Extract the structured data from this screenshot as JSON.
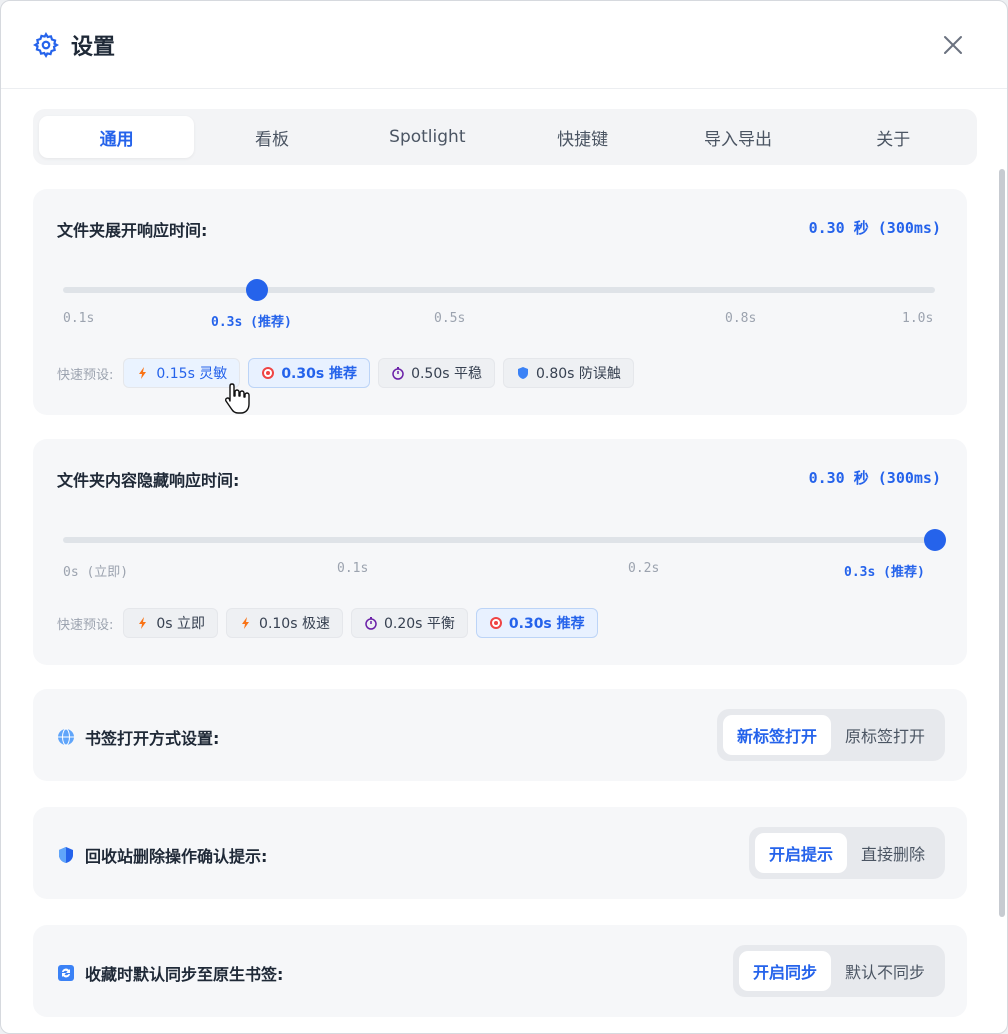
{
  "header": {
    "title": "设置",
    "icon": "gear-icon",
    "close_icon": "close-icon"
  },
  "tabs": [
    {
      "label": "通用",
      "active": true
    },
    {
      "label": "看板",
      "active": false
    },
    {
      "label": "Spotlight",
      "active": false
    },
    {
      "label": "快捷键",
      "active": false
    },
    {
      "label": "导入导出",
      "active": false
    },
    {
      "label": "关于",
      "active": false
    }
  ],
  "expand_setting": {
    "title": "文件夹展开响应时间:",
    "value_display": "0.30 秒 (300ms)",
    "slider_value": 0.3,
    "slider_min": 0.1,
    "slider_max": 1.0,
    "ticks": [
      "0.1s",
      "0.3s (推荐)",
      "0.5s",
      "0.8s",
      "1.0s"
    ],
    "presets_label": "快速预设:",
    "presets": [
      {
        "label": "0.15s 灵敏",
        "icon": "lightning-icon"
      },
      {
        "label": "0.30s 推荐",
        "icon": "target-icon",
        "selected": true
      },
      {
        "label": "0.50s 平稳",
        "icon": "stopwatch-icon"
      },
      {
        "label": "0.80s 防误触",
        "icon": "shield-icon"
      }
    ]
  },
  "hide_setting": {
    "title": "文件夹内容隐藏响应时间:",
    "value_display": "0.30 秒 (300ms)",
    "slider_value": 0.3,
    "slider_min": 0,
    "slider_max": 0.3,
    "ticks": [
      "0s (立即)",
      "0.1s",
      "0.2s",
      "0.3s (推荐)"
    ],
    "presets_label": "快速预设:",
    "presets": [
      {
        "label": "0s 立即",
        "icon": "lightning-icon"
      },
      {
        "label": "0.10s 极速",
        "icon": "lightning-icon"
      },
      {
        "label": "0.20s 平衡",
        "icon": "stopwatch-icon"
      },
      {
        "label": "0.30s 推荐",
        "icon": "target-icon",
        "selected": true
      }
    ]
  },
  "bookmark_open": {
    "title": "书签打开方式设置:",
    "icon": "globe-icon",
    "options": [
      "新标签打开",
      "原标签打开"
    ],
    "selected": "新标签打开"
  },
  "trash_confirm": {
    "title": "回收站删除操作确认提示:",
    "icon": "shield-icon",
    "options": [
      "开启提示",
      "直接删除"
    ],
    "selected": "开启提示"
  },
  "sync_favorites": {
    "title": "收藏时默认同步至原生书签:",
    "icon": "sync-icon",
    "options": [
      "开启同步",
      "默认不同步"
    ],
    "selected": "开启同步"
  },
  "colors": {
    "accent": "#2563eb",
    "card_bg": "#f6f7f9",
    "track": "#dfe3e8"
  }
}
